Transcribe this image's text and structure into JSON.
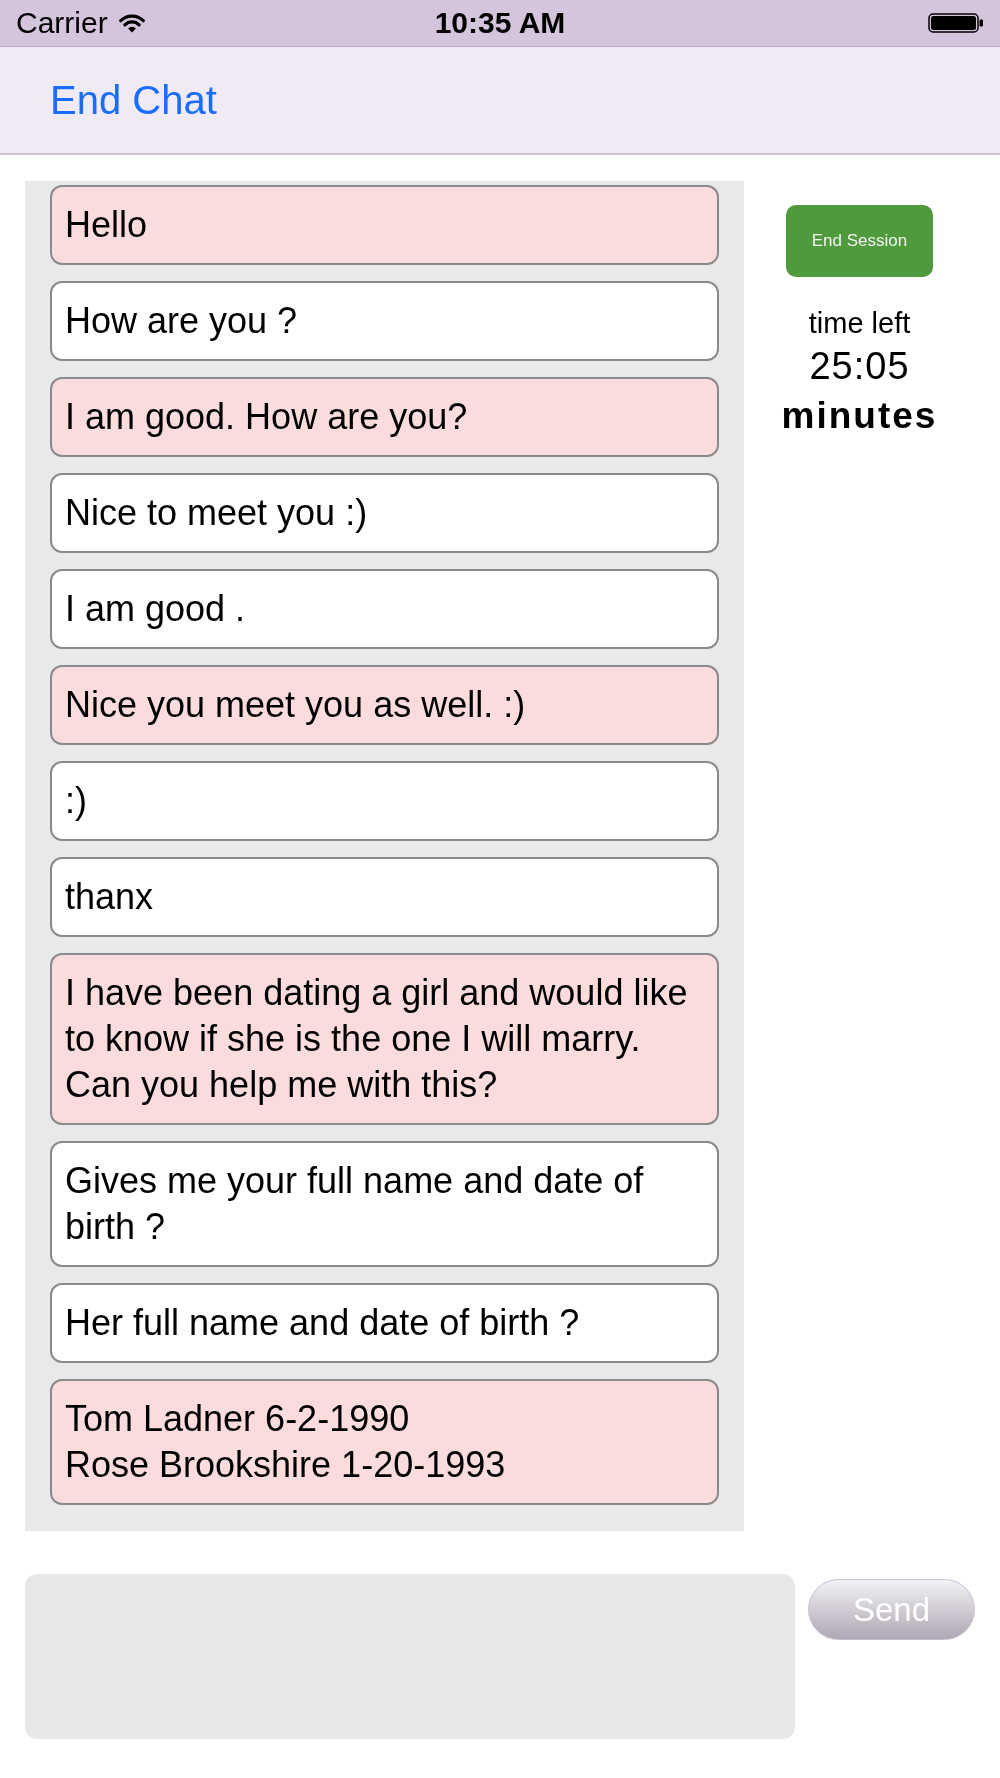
{
  "status_bar": {
    "carrier": "Carrier",
    "time": "10:35 AM"
  },
  "nav_bar": {
    "back_button": "End Chat"
  },
  "messages": [
    {
      "kind": "incoming",
      "text": "Hello"
    },
    {
      "kind": "outgoing",
      "text": "How are you ?"
    },
    {
      "kind": "incoming",
      "text": "I am good. How are you?"
    },
    {
      "kind": "outgoing",
      "text": "Nice to meet you :)"
    },
    {
      "kind": "outgoing",
      "text": "I am good ."
    },
    {
      "kind": "incoming",
      "text": "Nice you meet you as well. :)"
    },
    {
      "kind": "outgoing",
      "text": ":)"
    },
    {
      "kind": "outgoing",
      "text": "thanx"
    },
    {
      "kind": "incoming",
      "text": "I have been dating a girl and would like to know if she is the one I will marry. Can you help me with this?"
    },
    {
      "kind": "outgoing",
      "text": "Gives me your full name and date of birth ?"
    },
    {
      "kind": "outgoing",
      "text": "Her full name and date of birth ?"
    },
    {
      "kind": "incoming",
      "text": "Tom Ladner 6-2-1990\nRose Brookshire 1-20-1993"
    }
  ],
  "session_panel": {
    "end_button": "End Session",
    "time_label": "time left",
    "time_value": "25:05",
    "time_unit": "minutes"
  },
  "composer": {
    "send_button": "Send"
  }
}
